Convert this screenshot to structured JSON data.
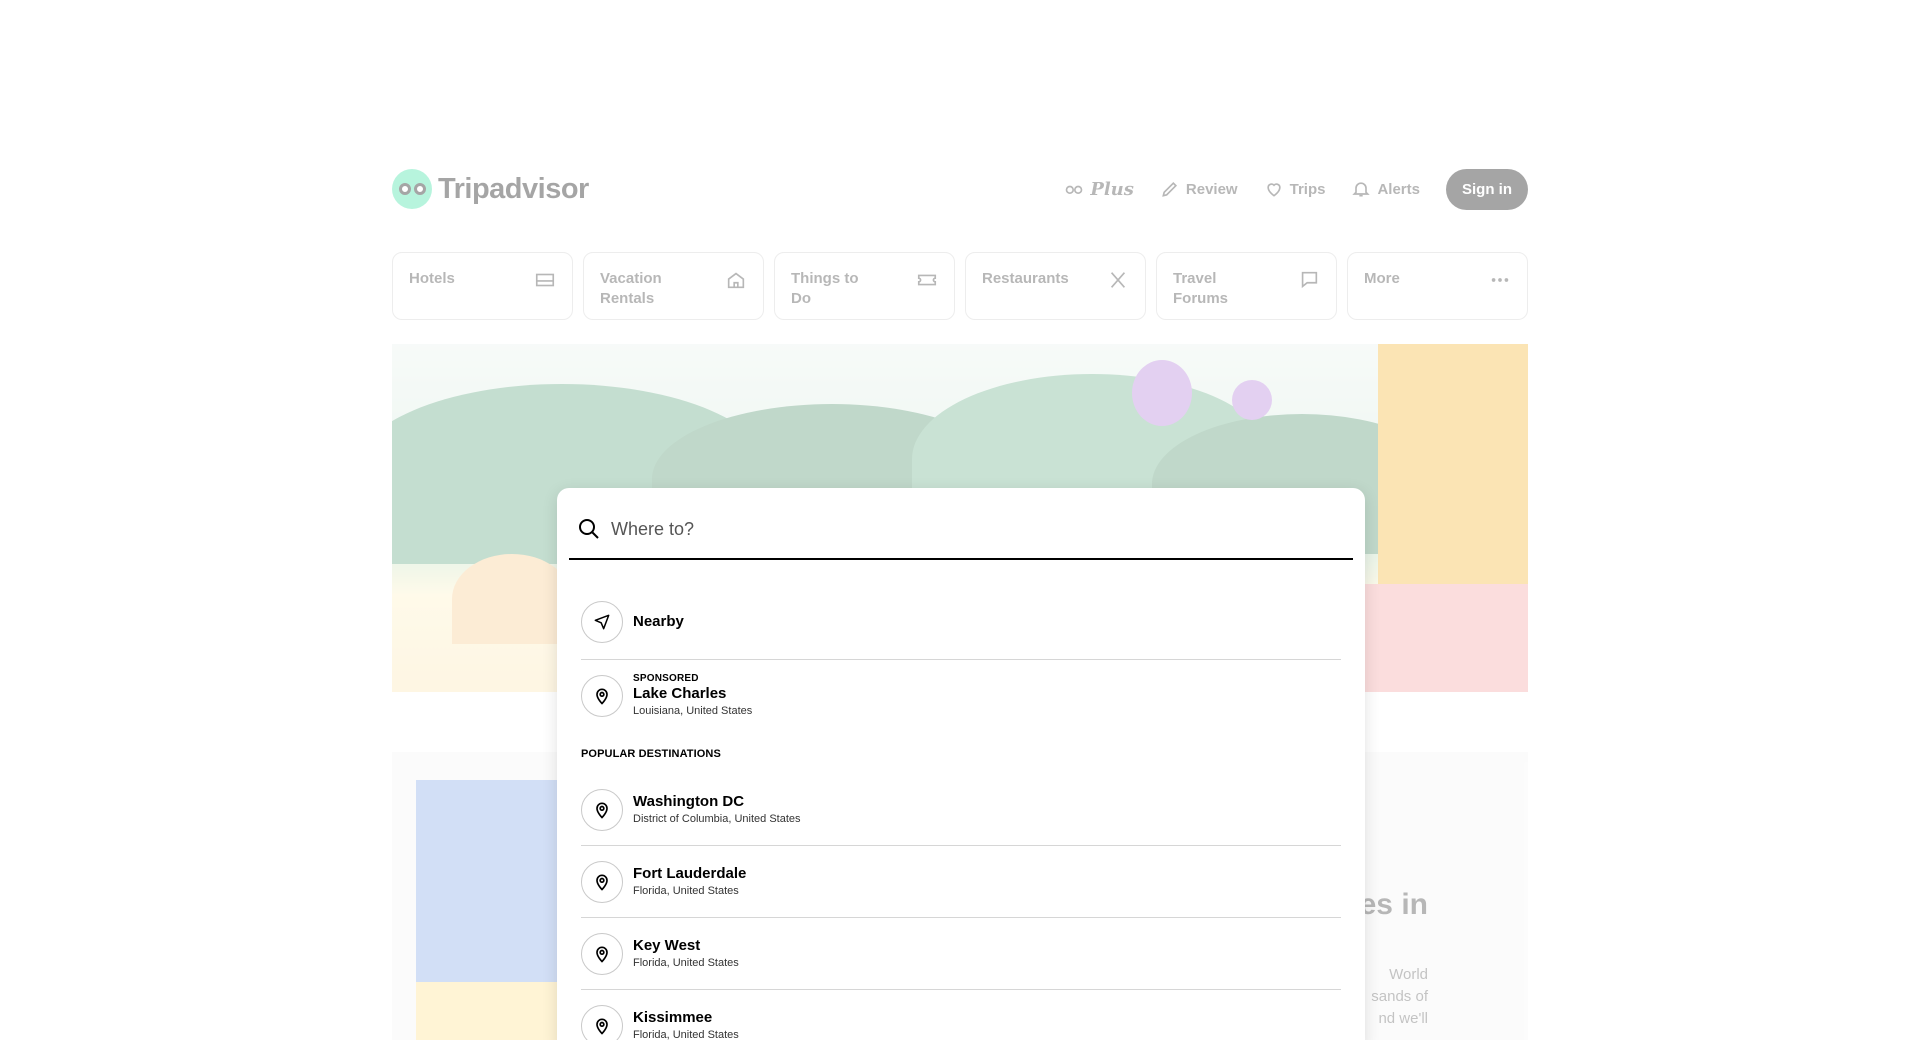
{
  "header": {
    "brand": "Tripadvisor",
    "plus_label": "Plus",
    "review_label": "Review",
    "trips_label": "Trips",
    "alerts_label": "Alerts",
    "signin_label": "Sign in"
  },
  "nav": {
    "items": [
      {
        "label": "Hotels",
        "icon": "bed-icon"
      },
      {
        "label": "Vacation Rentals",
        "icon": "house-icon"
      },
      {
        "label": "Things to Do",
        "icon": "ticket-icon"
      },
      {
        "label": "Restaurants",
        "icon": "utensils-icon"
      },
      {
        "label": "Travel Forums",
        "icon": "chat-icon"
      },
      {
        "label": "More",
        "icon": "ellipsis-icon"
      }
    ]
  },
  "promo": {
    "title_fragment": "es in",
    "body_fragment": "World sands of nd we'll"
  },
  "search": {
    "placeholder": "Where to?",
    "nearby_label": "Nearby",
    "sponsored": {
      "tag": "SPONSORED",
      "name": "Lake Charles",
      "region": "Louisiana, United States"
    },
    "section_label": "POPULAR DESTINATIONS",
    "destinations": [
      {
        "name": "Washington DC",
        "region": "District of Columbia, United States"
      },
      {
        "name": "Fort Lauderdale",
        "region": "Florida, United States"
      },
      {
        "name": "Key West",
        "region": "Florida, United States"
      },
      {
        "name": "Kissimmee",
        "region": "Florida, United States"
      }
    ]
  },
  "colors": {
    "brand_green": "#34e0a1",
    "signin_bg": "#000000",
    "divider": "#d6d6d6"
  }
}
